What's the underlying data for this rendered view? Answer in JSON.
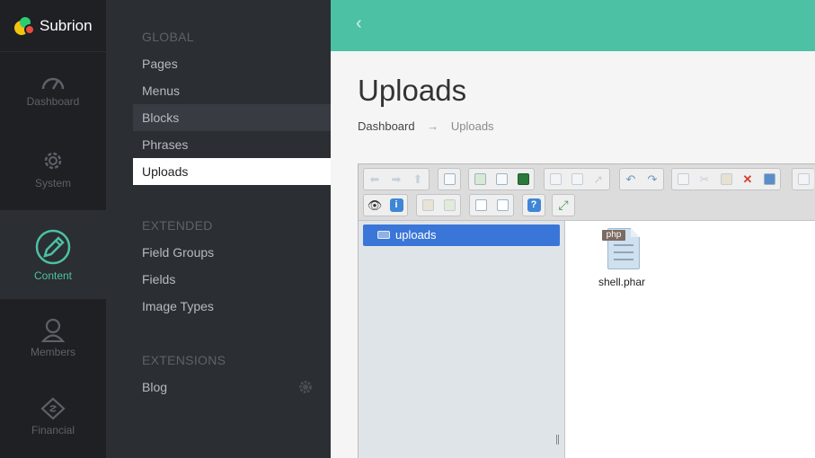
{
  "brand": {
    "name": "Subrion",
    "colors": {
      "accent": "#4cc1a4",
      "rail": "#1f2024",
      "submenu": "#2b2e33",
      "selection": "#3a76d8"
    }
  },
  "rail": [
    {
      "label": "Dashboard",
      "icon": "speedometer-icon"
    },
    {
      "label": "System",
      "icon": "gear-icon"
    },
    {
      "label": "Content",
      "icon": "pencil-icon",
      "active": true
    },
    {
      "label": "Members",
      "icon": "user-icon"
    },
    {
      "label": "Financial",
      "icon": "tag-icon"
    }
  ],
  "submenu": {
    "global": {
      "heading": "GLOBAL",
      "items": [
        "Pages",
        "Menus",
        "Blocks",
        "Phrases",
        "Uploads"
      ]
    },
    "extended": {
      "heading": "EXTENDED",
      "items": [
        "Field Groups",
        "Fields",
        "Image Types"
      ]
    },
    "extensions": {
      "heading": "EXTENSIONS",
      "items": [
        "Blog"
      ]
    },
    "active_item": "Uploads",
    "hover_item": "Blocks"
  },
  "topbar": {
    "back_symbol": "‹"
  },
  "page": {
    "title": "Uploads",
    "breadcrumb": {
      "home": "Dashboard",
      "separator": "→",
      "current": "Uploads"
    }
  },
  "file_manager": {
    "tree": {
      "root": "uploads"
    },
    "files": [
      {
        "name": "shell.phar",
        "type_badge": "php"
      }
    ]
  }
}
